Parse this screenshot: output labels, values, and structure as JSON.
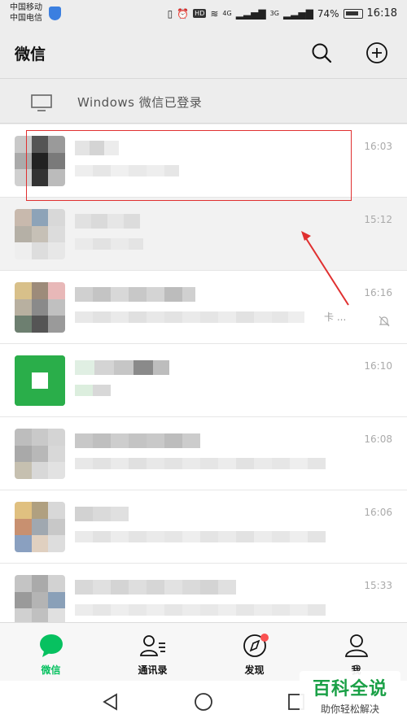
{
  "statusbar": {
    "carrier_1": "中国移动",
    "carrier_2": "中国电信",
    "net_4g": "4G",
    "net_3g": "3G",
    "battery_pct": "74%",
    "time": "16:18"
  },
  "header": {
    "title": "微信"
  },
  "login_bar": {
    "text": "Windows 微信已登录"
  },
  "chats": [
    {
      "time": "16:03"
    },
    {
      "time": "15:12"
    },
    {
      "time": "16:16",
      "suffix": "卡 ..."
    },
    {
      "time": "16:10"
    },
    {
      "time": "16:08"
    },
    {
      "time": "16:06"
    },
    {
      "time": "15:33"
    }
  ],
  "tabs": [
    {
      "label": "微信",
      "icon": "chat-bubble-icon",
      "active": true
    },
    {
      "label": "通讯录",
      "icon": "contacts-icon",
      "active": false
    },
    {
      "label": "发现",
      "icon": "compass-icon",
      "active": false
    },
    {
      "label": "我",
      "icon": "person-icon",
      "active": false
    }
  ],
  "watermark": {
    "big": "百科全说",
    "small": "助你轻松解决"
  },
  "colors": {
    "accent": "#07c160",
    "badge": "#fa5151",
    "annotation": "#e03030"
  }
}
